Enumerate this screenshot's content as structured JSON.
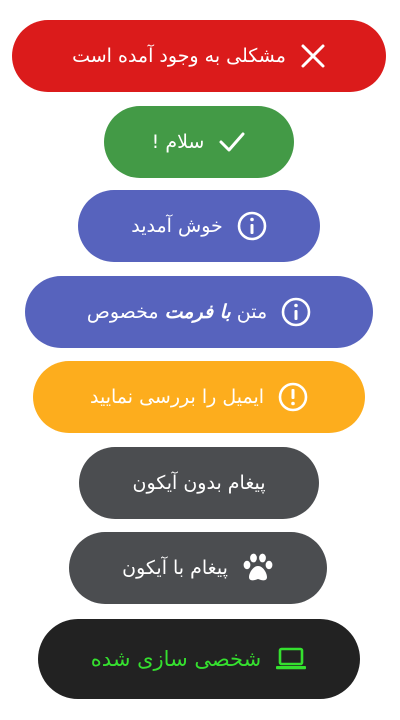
{
  "toasts": {
    "error": {
      "text": "مشکلی به وجود آمده است",
      "icon": "close-icon",
      "color": "#db1b1b"
    },
    "success": {
      "text": "سلام !",
      "icon": "check-icon",
      "color": "#439a46"
    },
    "info": {
      "text": "خوش آمدید",
      "icon": "info-icon",
      "color": "#5763bd"
    },
    "formatted": {
      "before": "متن ",
      "bold": "با فرمت",
      "after": " مخصوص",
      "icon": "info-icon",
      "color": "#5763bd"
    },
    "warning": {
      "text": "ایمیل را بررسی نمایید",
      "icon": "warning-icon",
      "color": "#fdad1d"
    },
    "plain": {
      "text": "پیغام بدون آیکون",
      "color": "#4b4d50"
    },
    "with_icon": {
      "text": "پیغام با آیکون",
      "icon": "paw-icon",
      "color": "#4b4d50"
    },
    "custom": {
      "text": "شخصی سازی شده",
      "icon": "laptop-icon",
      "color": "#222222",
      "text_color": "#35e02f"
    }
  }
}
